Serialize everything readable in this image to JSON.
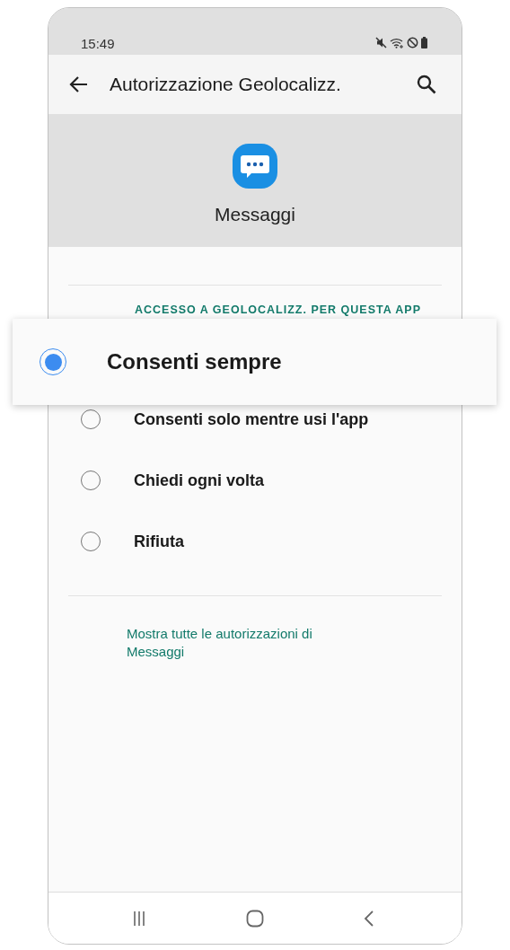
{
  "status_bar": {
    "time": "15:49"
  },
  "app_bar": {
    "title": "Autorizzazione Geolocalizz."
  },
  "app": {
    "name": "Messaggi"
  },
  "section": {
    "title": "ACCESSO A GEOLOCALIZZ. PER QUESTA APP"
  },
  "options": [
    {
      "label": "Consenti sempre",
      "selected": true,
      "highlighted": true
    },
    {
      "label": "Consenti solo mentre usi l'app",
      "selected": false,
      "highlighted": false
    },
    {
      "label": "Chiedi ogni volta",
      "selected": false,
      "highlighted": false
    },
    {
      "label": "Rifiuta",
      "selected": false,
      "highlighted": false
    }
  ],
  "link": "Mostra tutte le autorizzazioni di Messaggi"
}
